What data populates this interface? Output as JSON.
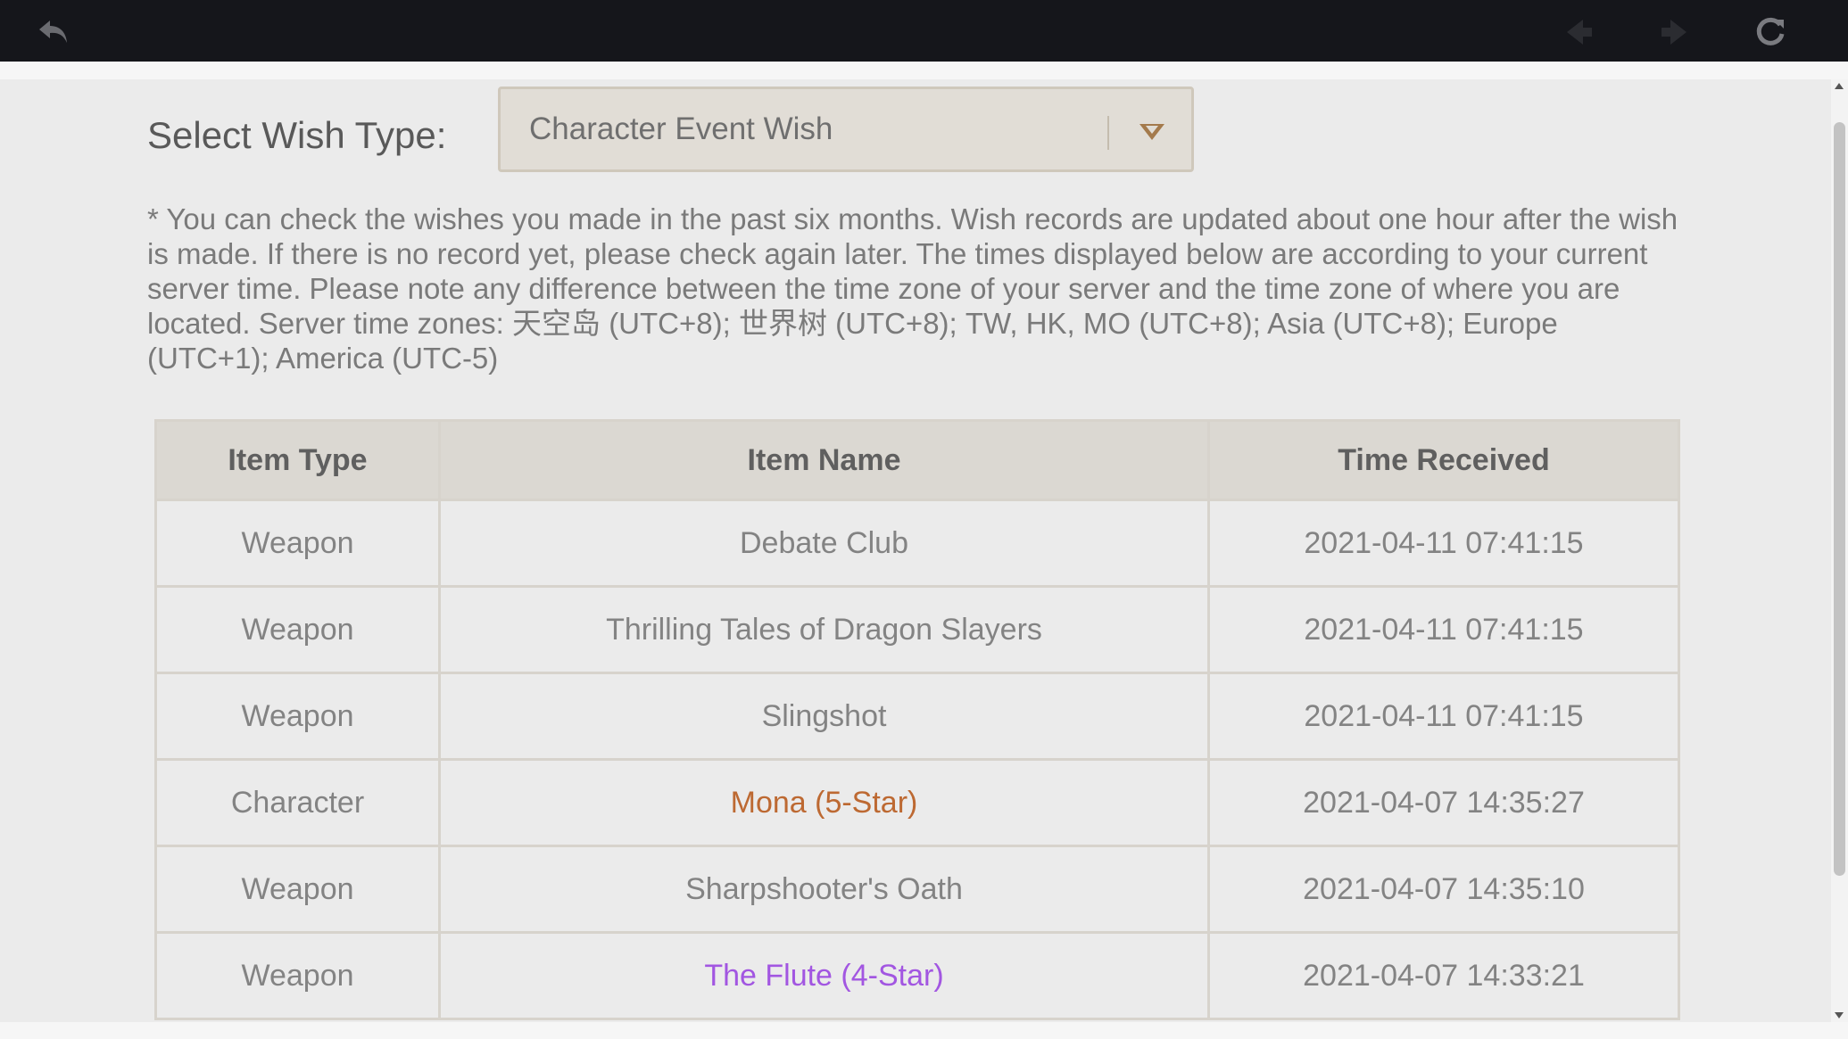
{
  "toolbar": {
    "back_icon": "back-arrow-icon",
    "prev_icon": "previous-page-icon",
    "next_icon": "next-page-icon",
    "reload_icon": "reload-icon"
  },
  "wish_select": {
    "label": "Select Wish Type:",
    "value": "Character Event Wish",
    "icon": "chevron-down-icon"
  },
  "notice": "* You can check the wishes you made in the past six months. Wish records are updated about one hour after the wish is made. If there is no record yet, please check again later. The times displayed below are according to your current server time. Please note any difference between the time zone of your server and the time zone of where you are located. Server time zones: 天空岛 (UTC+8); 世界树 (UTC+8); TW, HK, MO (UTC+8); Asia (UTC+8); Europe (UTC+1); America (UTC-5)",
  "table": {
    "headers": [
      "Item Type",
      "Item Name",
      "Time Received"
    ],
    "rows": [
      {
        "type": "Weapon",
        "name": "Debate Club",
        "time": "2021-04-11 07:41:15",
        "rarity": ""
      },
      {
        "type": "Weapon",
        "name": "Thrilling Tales of Dragon Slayers",
        "time": "2021-04-11 07:41:15",
        "rarity": ""
      },
      {
        "type": "Weapon",
        "name": "Slingshot",
        "time": "2021-04-11 07:41:15",
        "rarity": ""
      },
      {
        "type": "Character",
        "name": "Mona (5-Star)",
        "time": "2021-04-07 14:35:27",
        "rarity": "5"
      },
      {
        "type": "Weapon",
        "name": "Sharpshooter's Oath",
        "time": "2021-04-07 14:35:10",
        "rarity": ""
      },
      {
        "type": "Weapon",
        "name": "The Flute (4-Star)",
        "time": "2021-04-07 14:33:21",
        "rarity": "4"
      }
    ]
  },
  "colors": {
    "toolbar_bg": "#15161b",
    "five_star": "#bd6932",
    "four_star": "#a256e1",
    "header_bg": "#dbd8d2"
  }
}
